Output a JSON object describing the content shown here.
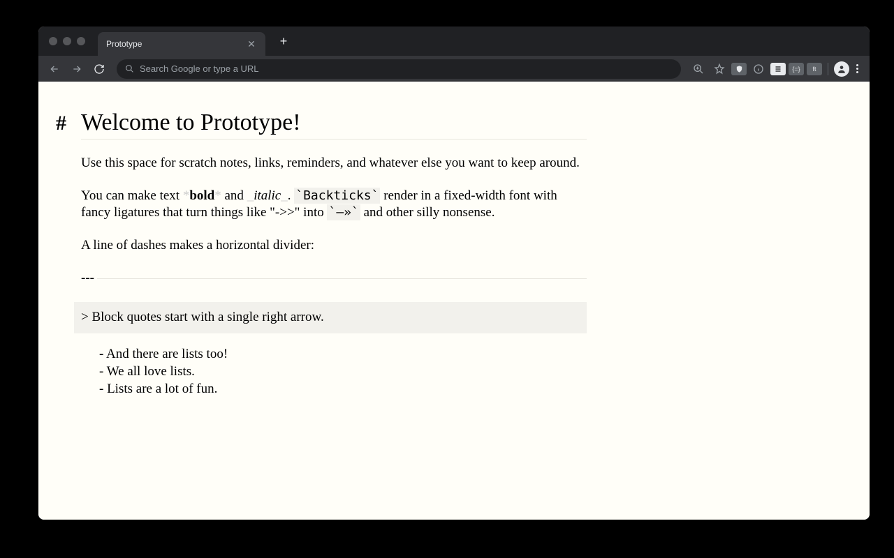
{
  "browser": {
    "tab_title": "Prototype",
    "omnibox_placeholder": "Search Google or type a URL"
  },
  "document": {
    "heading_marker": "#",
    "heading": "Welcome to Prototype!",
    "para1": "Use this space for scratch notes, links, reminders, and whatever else you want to keep around.",
    "para2": {
      "a": "You can make text ",
      "bold_marker": "*",
      "bold": "bold",
      "b": " and ",
      "italic_marker": "_",
      "italic": "italic",
      "c": ". ",
      "code1": "`Backticks`",
      "d": " render in a fixed-width font with fancy ligatures that turn things like \"->>\" into ",
      "code2": "`—»`",
      "e": " and other silly nonsense."
    },
    "para3": "A line of dashes makes a horizontal divider:",
    "hr_marker": "---",
    "blockquote": "> Block quotes start with a single right arrow.",
    "list": [
      "And there are lists too!",
      "We all love lists.",
      "Lists are a lot of fun."
    ]
  }
}
